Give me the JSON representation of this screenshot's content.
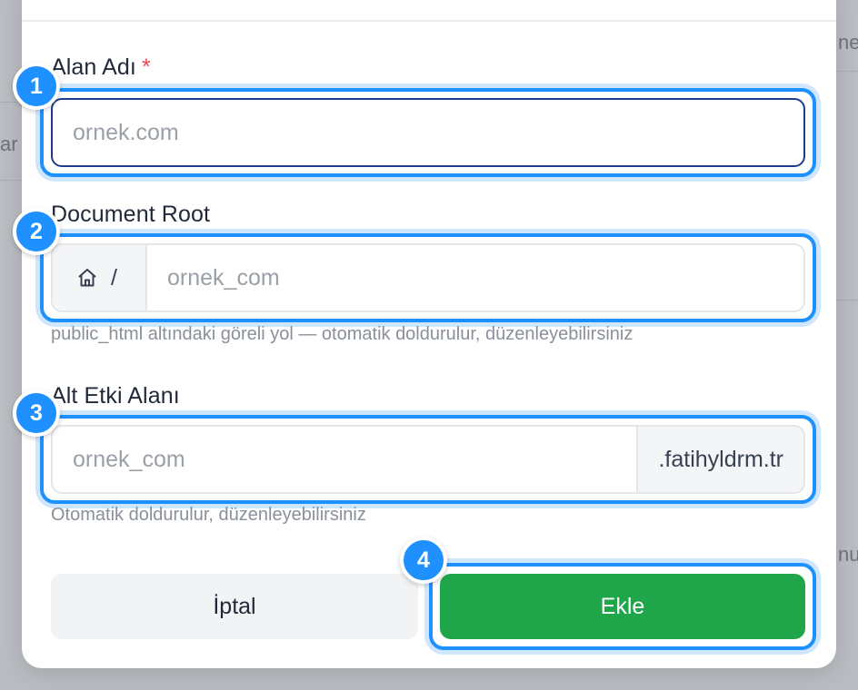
{
  "background": {
    "frag_right_top": "ne",
    "frag_left": "ar",
    "frag_right_bottom": "nu"
  },
  "form": {
    "domain": {
      "label": "Alan Adı",
      "required_mark": "*",
      "placeholder": "ornek.com",
      "value": ""
    },
    "document_root": {
      "label": "Document Root",
      "prefix_icon": "home-icon",
      "prefix_text": "/",
      "placeholder": "ornek_com",
      "value": "",
      "hint": "public_html altındaki göreli yol — otomatik doldurulur, düzenleyebilirsiniz"
    },
    "subdomain": {
      "label": "Alt Etki Alanı",
      "placeholder": "ornek_com",
      "value": "",
      "suffix": ".fatihyldrm.tr",
      "hint": "Otomatik doldurulur, düzenleyebilirsiniz"
    }
  },
  "actions": {
    "cancel_label": "İptal",
    "submit_label": "Ekle"
  },
  "annotations": [
    "1",
    "2",
    "3",
    "4"
  ],
  "colors": {
    "accent": "#1e90ff",
    "primary_button": "#1fa64a",
    "required": "#e5484d"
  }
}
